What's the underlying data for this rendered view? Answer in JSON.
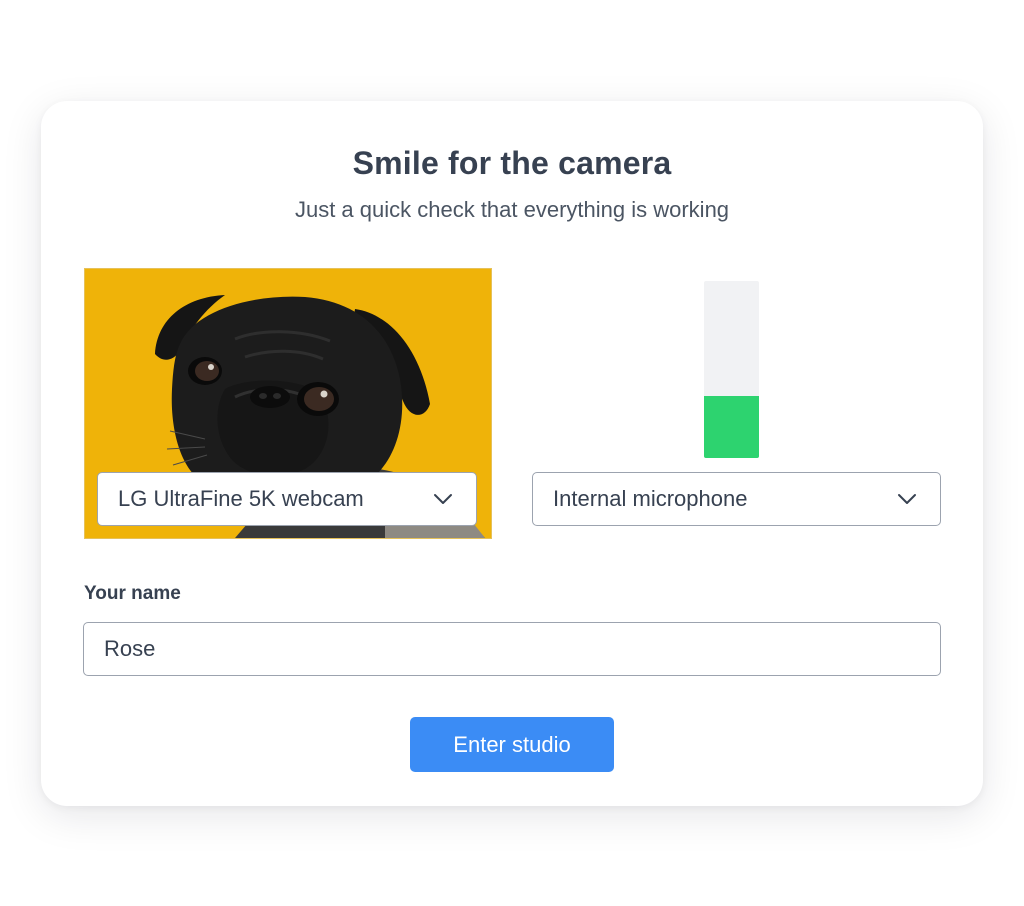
{
  "dialog": {
    "title": "Smile for the camera",
    "subtitle": "Just a quick check that everything is working"
  },
  "camera": {
    "selected_device": "LG UltraFine 5K webcam",
    "preview_background_color": "#efb309",
    "dropdown_icon": "chevron-down-icon"
  },
  "microphone": {
    "selected_device": "Internal microphone",
    "input_level": 0.35,
    "level_color": "#2dd36f",
    "dropdown_icon": "chevron-down-icon"
  },
  "name_field": {
    "label": "Your name",
    "value": "Rose"
  },
  "enter_button": {
    "label": "Enter studio",
    "color": "#3b8cf5"
  }
}
